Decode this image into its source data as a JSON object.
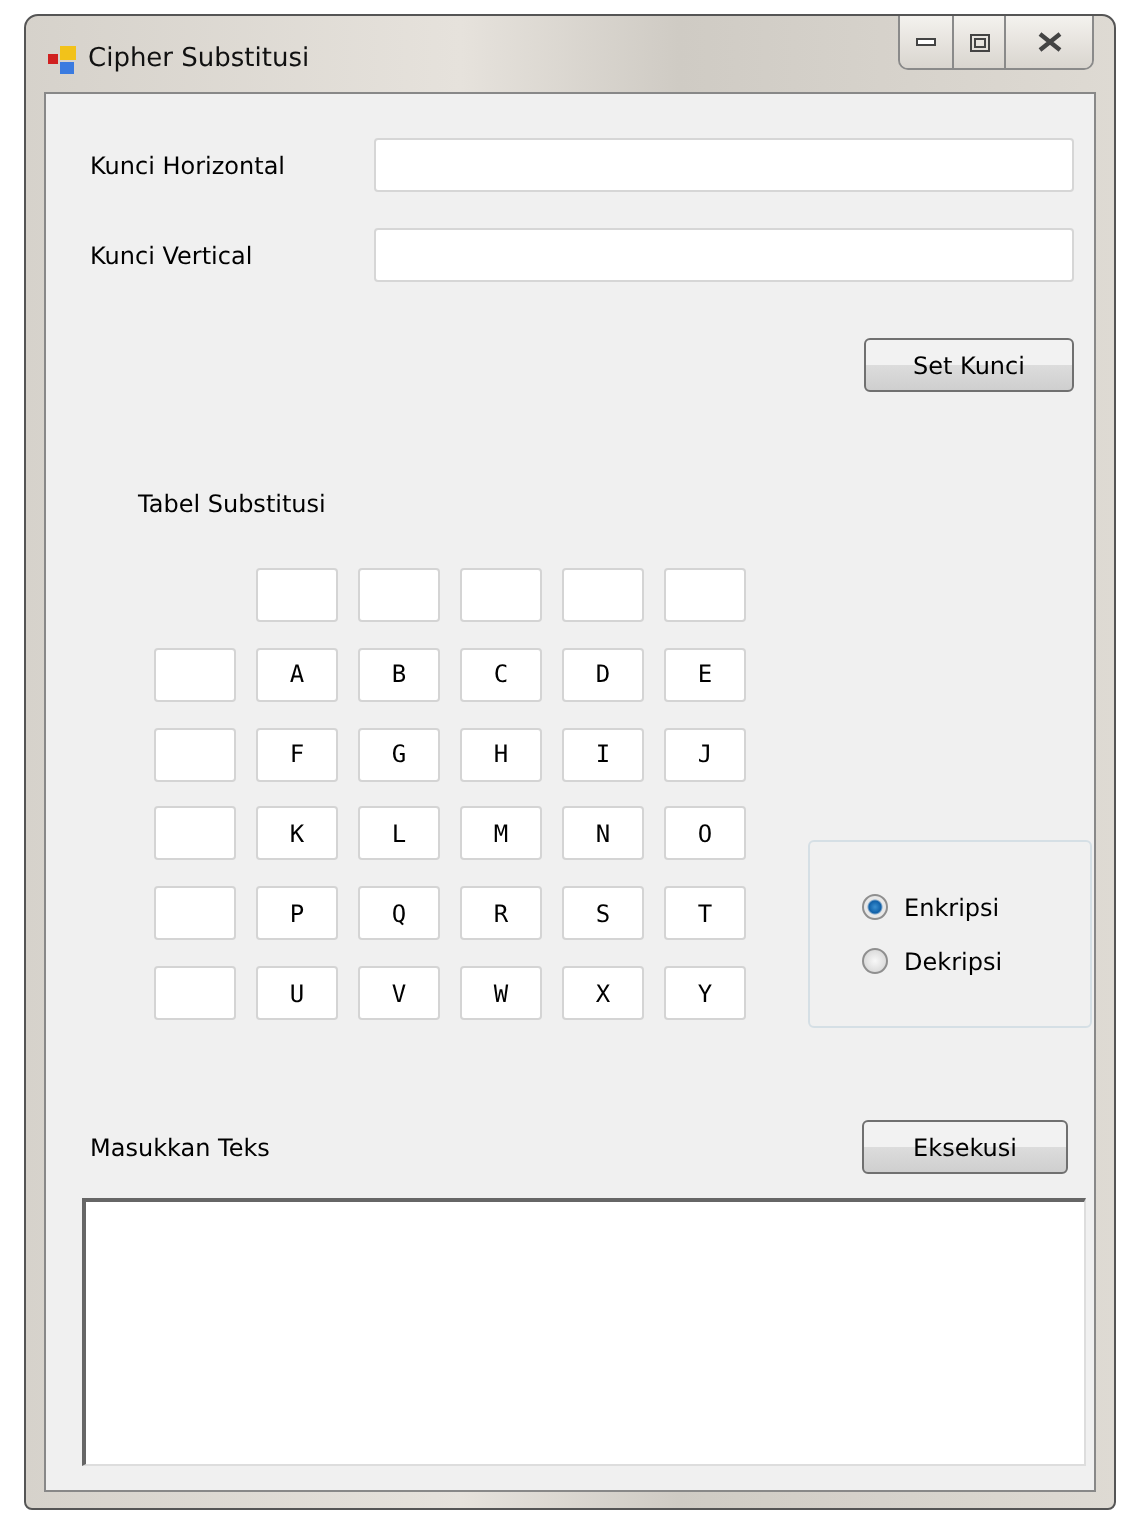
{
  "window": {
    "title": "Cipher Substitusi"
  },
  "keys": [
    {
      "label": "Kunci Horizontal"
    },
    {
      "label": "Kunci Vertical"
    }
  ],
  "set_button": "Set Kunci",
  "table": {
    "title": "Tabel Substitusi",
    "rows": [
      {
        "cells": [
          "A",
          "B",
          "C",
          "D",
          "E"
        ]
      },
      {
        "cells": [
          "F",
          "G",
          "H",
          "I",
          "J"
        ]
      },
      {
        "cells": [
          "K",
          "L",
          "M",
          "N",
          "O"
        ]
      },
      {
        "cells": [
          "P",
          "Q",
          "R",
          "S",
          "T"
        ]
      },
      {
        "cells": [
          "U",
          "V",
          "W",
          "X",
          "Y"
        ]
      }
    ]
  },
  "mode": [
    {
      "label": "Enkripsi",
      "selected": true
    },
    {
      "label": "Dekripsi",
      "selected": false
    }
  ],
  "input": {
    "label": "Masukkan Teks"
  },
  "run_button": "Eksekusi"
}
